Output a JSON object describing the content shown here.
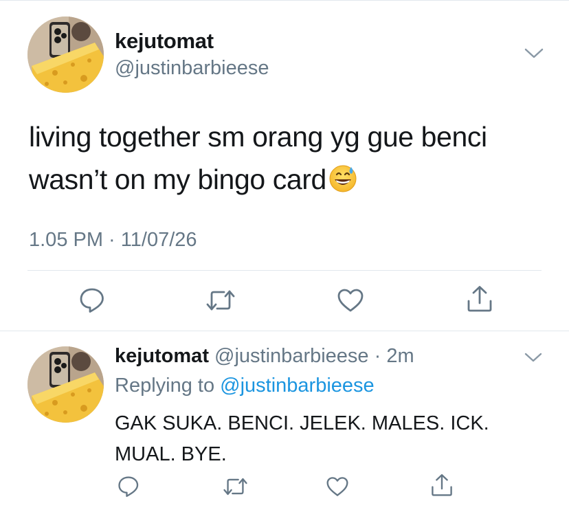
{
  "main_tweet": {
    "author_name": "kejutomat",
    "author_handle": "@justinbarbieese",
    "text": "living together sm orang yg gue benci\nwasn’t on my bingo card",
    "emoji": "grinning-face-with-sweat",
    "time": "1.05 PM",
    "separator": " · ",
    "date": "11/07/26"
  },
  "reply": {
    "author_name": "kejutomat",
    "author_handle": "@justinbarbieese",
    "dot": " · ",
    "time": "2m",
    "replying_prefix": "Replying to ",
    "replying_to": "@justinbarbieese",
    "text": "GAK SUKA. BENCI. JELEK. MALES. ICK.\nMUAL. BYE."
  },
  "icons": {
    "reply": "comment-icon",
    "retweet": "retweet-icon",
    "like": "heart-icon",
    "share": "share-icon",
    "menu": "chevron-down-icon"
  },
  "colors": {
    "text": "#14171a",
    "secondary": "#657786",
    "link": "#1b95e0",
    "divider": "#e1e8ed"
  }
}
